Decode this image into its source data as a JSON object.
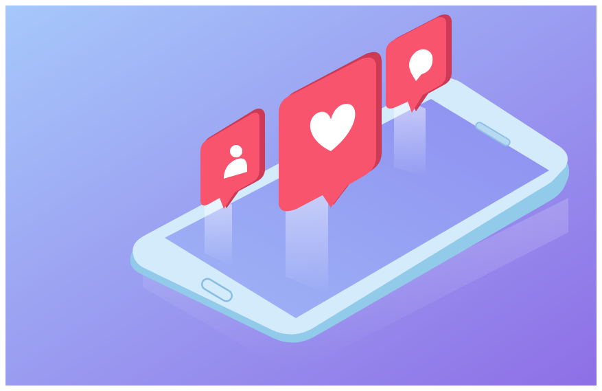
{
  "scene": {
    "subject": "smartphone-with-notification-bubbles",
    "colors": {
      "bg_top_left": "#a6c8fb",
      "bg_bottom_right": "#8e6fe6",
      "phone_body": "#d4ebfb",
      "phone_edge": "#92cbea",
      "screen_top": "#8d8ff0",
      "screen_bottom": "#9fb4f6",
      "bubble_face": "#f8546e",
      "bubble_side": "#cc3a55",
      "icon_fill": "#ffffff"
    },
    "bubbles": [
      {
        "icon": "user-icon"
      },
      {
        "icon": "heart-icon"
      },
      {
        "icon": "comment-icon"
      }
    ]
  }
}
